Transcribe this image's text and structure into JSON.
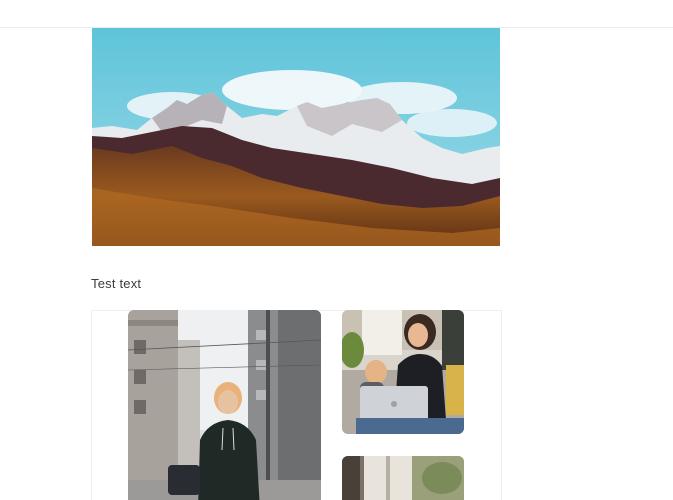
{
  "content": {
    "caption": "Test text"
  },
  "images": {
    "hero": "snowy-mountain-peaks-over-autumn-forest",
    "street": "person-in-dark-hoodie-on-city-street",
    "laptop": "woman-with-laptop-and-child-on-couch",
    "window": "room-window-with-greenery"
  },
  "colors": {
    "sky": "#6ec8dc",
    "forest": "#8a4e1c",
    "border": "#efefef",
    "text": "#3d3d3d"
  }
}
